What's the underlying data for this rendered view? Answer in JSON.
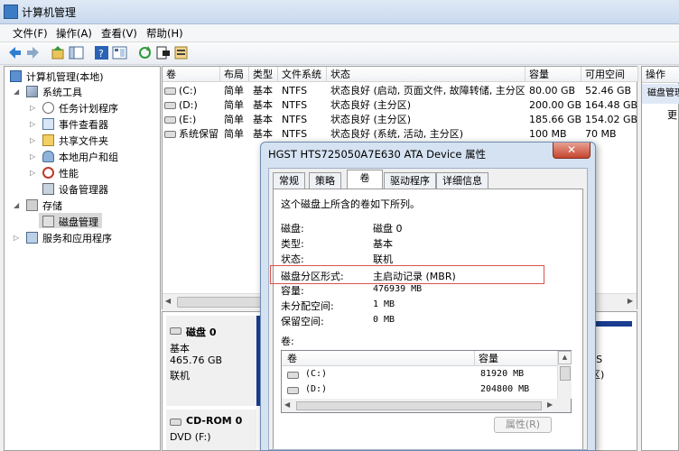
{
  "window": {
    "title": "计算机管理"
  },
  "menu": [
    "文件(F)",
    "操作(A)",
    "查看(V)",
    "帮助(H)"
  ],
  "toolbar": [
    "back-icon",
    "forward-icon",
    "up-icon",
    "show-hide-tree-icon",
    "help-icon",
    "properties-icon",
    "refresh-icon",
    "export-icon",
    "options-icon"
  ],
  "tree": {
    "root": "计算机管理(本地)",
    "system_tools": "系统工具",
    "task_scheduler": "任务计划程序",
    "event_viewer": "事件查看器",
    "shared_folders": "共享文件夹",
    "local_users": "本地用户和组",
    "performance": "性能",
    "device_manager": "设备管理器",
    "storage": "存储",
    "disk_management": "磁盘管理",
    "services_apps": "服务和应用程序"
  },
  "volumes": {
    "headers": [
      "卷",
      "布局",
      "类型",
      "文件系统",
      "状态",
      "容量",
      "可用空间"
    ],
    "rows": [
      [
        "(C:)",
        "简单",
        "基本",
        "NTFS",
        "状态良好 (启动, 页面文件, 故障转储, 主分区)",
        "80.00 GB",
        "52.46 GB"
      ],
      [
        "(D:)",
        "简单",
        "基本",
        "NTFS",
        "状态良好 (主分区)",
        "200.00 GB",
        "164.48 GB"
      ],
      [
        "(E:)",
        "简单",
        "基本",
        "NTFS",
        "状态良好 (主分区)",
        "185.66 GB",
        "154.02 GB"
      ],
      [
        "系统保留",
        "简单",
        "基本",
        "NTFS",
        "状态良好 (系统, 活动, 主分区)",
        "100 MB",
        "70 MB"
      ]
    ]
  },
  "actions": {
    "header": "操作",
    "section": "磁盘管理",
    "more": "更"
  },
  "disks": {
    "disk0": {
      "name": "磁盘 0",
      "type": "基本",
      "size": "465.76 GB",
      "status": "联机"
    },
    "cdrom0": {
      "name": "CD-ROM 0",
      "drive": "DVD (F:)"
    },
    "partial_right_1": "FS",
    "partial_right_2": "区)"
  },
  "dialog": {
    "title": "HGST HTS725050A7E630 ATA Device 属性",
    "close": "✕",
    "tabs": [
      "常规",
      "策略",
      "卷",
      "驱动程序",
      "详细信息"
    ],
    "active_tab": "卷",
    "intro": "这个磁盘上所含的卷如下所列。",
    "fields": {
      "disk_label": "磁盘:",
      "disk_value": "磁盘 0",
      "type_label": "类型:",
      "type_value": "基本",
      "status_label": "状态:",
      "status_value": "联机",
      "partition_label": "磁盘分区形式:",
      "partition_value": "主启动记录 (MBR)",
      "capacity_label": "容量:",
      "capacity_value": "476939 MB",
      "unallocated_label": "未分配空间:",
      "unallocated_value": "1 MB",
      "reserved_label": "保留空间:",
      "reserved_value": "0 MB"
    },
    "volumes_label": "卷:",
    "vol_headers": [
      "卷",
      "容量"
    ],
    "vol_rows": [
      [
        "(C:)",
        "81920 MB"
      ],
      [
        "(D:)",
        "204800 MB"
      ]
    ],
    "properties_button": "属性(R)"
  },
  "colors": {
    "highlight_box": "#d9534f",
    "selection": "#cde8ff",
    "title_gradient": "#c9d9ee"
  }
}
